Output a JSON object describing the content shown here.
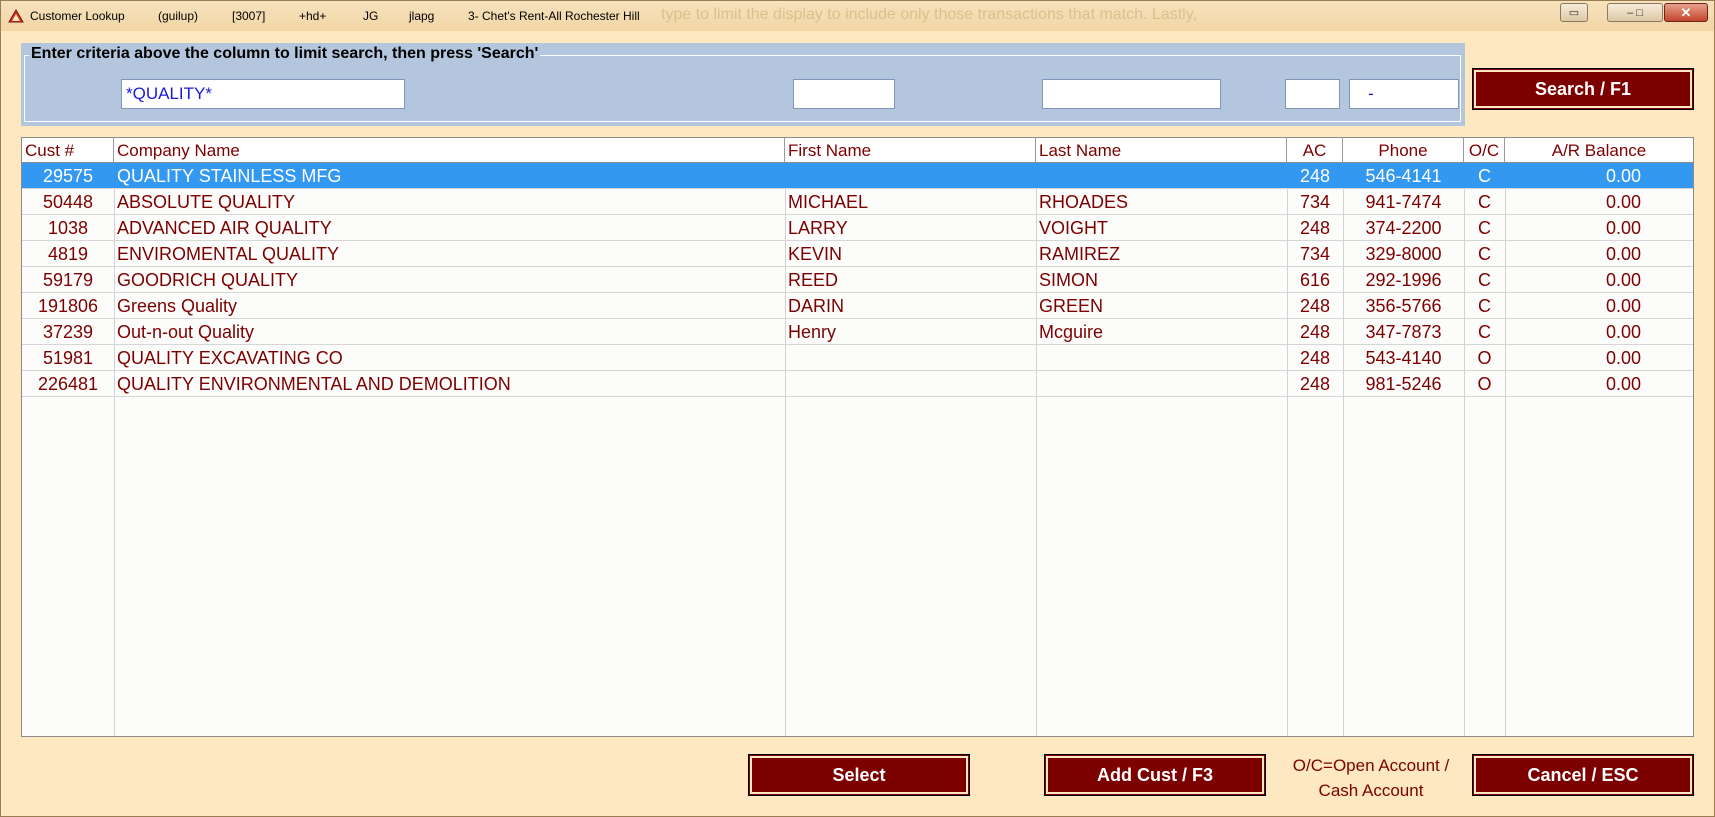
{
  "titlebar": {
    "title": "Customer Lookup",
    "user": "(guilup)",
    "code": "[3007]",
    "flag": "+hd+",
    "initials": "JG",
    "login": "jlapg",
    "store": "3-   Chet's Rent-All Rochester Hill",
    "ghost_text": "type to limit the display to include only those transactions that match.   Lastly,",
    "minimize_icon": "minimize-icon",
    "maximize_icon": "maximize-icon",
    "close_icon": "close-icon"
  },
  "criteria": {
    "legend": "Enter criteria above the column to limit search, then press 'Search'",
    "company_value": "*QUALITY*",
    "first_name_value": "",
    "last_name_value": "",
    "ac_value": "",
    "phone_value": "   -"
  },
  "buttons": {
    "search": "Search / F1",
    "select": "Select",
    "add_cust": "Add Cust / F3",
    "cancel": "Cancel  /  ESC"
  },
  "table": {
    "headers": {
      "cust": "Cust #",
      "company": "Company Name",
      "first": "First Name",
      "last": "Last Name",
      "ac": "AC",
      "phone": "Phone",
      "oc": "O/C",
      "balance": "A/R Balance"
    },
    "rows": [
      {
        "cust": "29575",
        "company": "QUALITY STAINLESS MFG",
        "first": "",
        "last": "",
        "ac": "248",
        "phone": "546-4141",
        "oc": "C",
        "balance": "0.00"
      },
      {
        "cust": "50448",
        "company": "ABSOLUTE QUALITY",
        "first": "MICHAEL",
        "last": "RHOADES",
        "ac": "734",
        "phone": "941-7474",
        "oc": "C",
        "balance": "0.00"
      },
      {
        "cust": "1038",
        "company": "ADVANCED AIR QUALITY",
        "first": "LARRY",
        "last": "VOIGHT",
        "ac": "248",
        "phone": "374-2200",
        "oc": "C",
        "balance": "0.00"
      },
      {
        "cust": "4819",
        "company": "ENVIROMENTAL QUALITY",
        "first": "KEVIN",
        "last": "RAMIREZ",
        "ac": "734",
        "phone": "329-8000",
        "oc": "C",
        "balance": "0.00"
      },
      {
        "cust": "59179",
        "company": "GOODRICH QUALITY",
        "first": "REED",
        "last": "SIMON",
        "ac": "616",
        "phone": "292-1996",
        "oc": "C",
        "balance": "0.00"
      },
      {
        "cust": "191806",
        "company": "Greens Quality",
        "first": "DARIN",
        "last": "GREEN",
        "ac": "248",
        "phone": "356-5766",
        "oc": "C",
        "balance": "0.00"
      },
      {
        "cust": "37239",
        "company": "Out-n-out Quality",
        "first": "Henry",
        "last": "Mcguire",
        "ac": "248",
        "phone": "347-7873",
        "oc": "C",
        "balance": "0.00"
      },
      {
        "cust": "51981",
        "company": "QUALITY EXCAVATING CO",
        "first": "",
        "last": "",
        "ac": "248",
        "phone": "543-4140",
        "oc": "O",
        "balance": "0.00"
      },
      {
        "cust": "226481",
        "company": "QUALITY ENVIRONMENTAL AND DEMOLITION",
        "first": "",
        "last": "",
        "ac": "248",
        "phone": "981-5246",
        "oc": "O",
        "balance": "0.00"
      }
    ],
    "selected_index": 0
  },
  "legend_note": {
    "line1": "O/C=Open Account /",
    "line2": "Cash Account"
  },
  "colors": {
    "window_bg": "#fde8c2",
    "accent": "#7d0000",
    "criteria_bg": "#b4c6dd",
    "selection": "#3398f2"
  }
}
